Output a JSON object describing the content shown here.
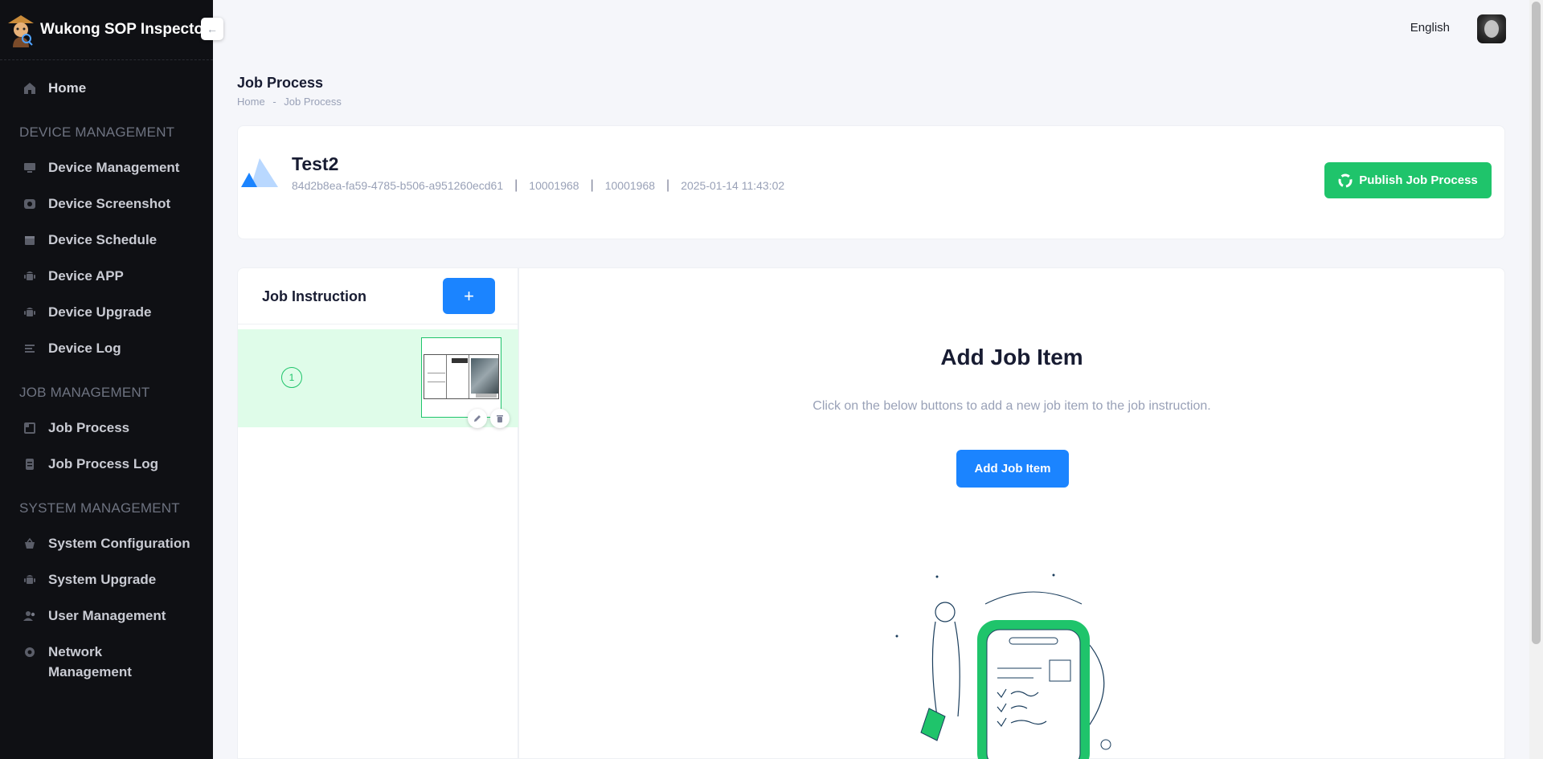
{
  "app": {
    "title": "Wukong SOP Inspector"
  },
  "sidebar": {
    "home": "Home",
    "sections": [
      {
        "title": "DEVICE MANAGEMENT",
        "items": [
          {
            "label": "Device Management",
            "icon": "monitor-icon"
          },
          {
            "label": "Device Screenshot",
            "icon": "screenshot-icon"
          },
          {
            "label": "Device Schedule",
            "icon": "calendar-icon"
          },
          {
            "label": "Device APP",
            "icon": "android-icon"
          },
          {
            "label": "Device Upgrade",
            "icon": "android-icon"
          },
          {
            "label": "Device Log",
            "icon": "list-icon"
          }
        ]
      },
      {
        "title": "JOB MANAGEMENT",
        "items": [
          {
            "label": "Job Process",
            "icon": "process-icon"
          },
          {
            "label": "Job Process Log",
            "icon": "log-icon"
          }
        ]
      },
      {
        "title": "SYSTEM MANAGEMENT",
        "items": [
          {
            "label": "System Configuration",
            "icon": "basket-icon"
          },
          {
            "label": "System Upgrade",
            "icon": "android-icon"
          },
          {
            "label": "User Management",
            "icon": "users-icon"
          },
          {
            "label": "Network Management",
            "icon": "gear-icon"
          }
        ]
      }
    ]
  },
  "header": {
    "language": "English"
  },
  "page": {
    "title": "Job Process",
    "breadcrumb": [
      "Home",
      "-",
      "Job Process"
    ]
  },
  "job": {
    "name": "Test2",
    "id": "84d2b8ea-fa59-4785-b506-a951260ecd61",
    "code1": "10001968",
    "code2": "10001968",
    "created": "2025-01-14 11:43:02",
    "publish_label": "Publish Job Process",
    "separator": "|"
  },
  "instructions": {
    "title": "Job Instruction",
    "add_label": "+",
    "items": [
      {
        "step": "1"
      }
    ]
  },
  "main": {
    "title": "Add Job Item",
    "description": "Click on the below buttons to add a new job item to the job instruction.",
    "button_label": "Add Job Item"
  },
  "colors": {
    "accent": "#1b84ff",
    "success": "#1fc46b",
    "sidebar": "#0f1014",
    "selected": "#dffce9"
  }
}
